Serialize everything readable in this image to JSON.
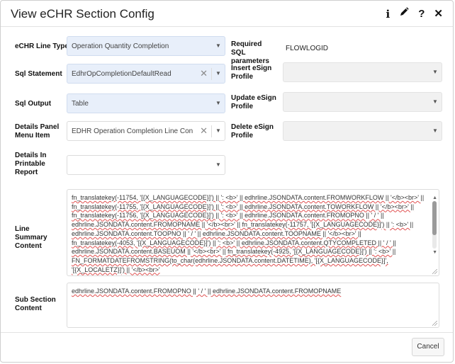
{
  "dialog": {
    "title": "View eCHR Section Config",
    "icons": [
      "info-icon",
      "pencil-icon",
      "help-icon",
      "close-icon"
    ]
  },
  "fields": {
    "line_type": {
      "label": "eCHR Line Type",
      "value": "Operation Quantity Completion"
    },
    "sql_statement": {
      "label": "Sql Statement",
      "value": "EdhrOpCompletionDefaultRead"
    },
    "sql_output": {
      "label": "Sql Output",
      "value": "Table"
    },
    "details_panel": {
      "label": "Details Panel Menu Item",
      "value": "EDHR Operation Completion Line Con..."
    },
    "details_printable": {
      "label": "Details In Printable Report",
      "value": ""
    },
    "required_sql": {
      "label": "Required SQL parameters",
      "value": "FLOWLOGID"
    },
    "insert_esign": {
      "label": "Insert eSign Profile",
      "value": ""
    },
    "update_esign": {
      "label": "Update eSign Profile",
      "value": ""
    },
    "delete_esign": {
      "label": "Delete eSign Profile",
      "value": ""
    },
    "line_summary": {
      "label": "Line Summary Content",
      "value": "fn_translatekey(-11754, '[{X_LANGUAGECODE}]') || ': <b>' || edhrline.JSONDATA.content.FROMWORKFLOW || '</b><br>' || fn_translatekey(-11755, '[{X_LANGUAGECODE}]') || ': <b>' || edhrline.JSONDATA.content.TOWORKFLOW || '</b><br>' || fn_translatekey(-11756, '[{X_LANGUAGECODE}]') || ': <b>' || edhrline.JSONDATA.content.FROMOPNO || ' / ' || edhrline.JSONDATA.content.FROMOPNAME || '</b><br>' || fn_translatekey(-11757, '[{X_LANGUAGECODE}]') || ': <b>' || edhrline.JSONDATA.content.TOOPNO || ' / ' || edhrline.JSONDATA.content.TOOPNAME || '</b><br>' || fn_translatekey(-4053, '[{X_LANGUAGECODE}]') || ': <b>' || edhrline.JSONDATA.content.QTYCOMPLETED || ' / ' || edhrline.JSONDATA.content.BASEUOM || '</b><br>' || fn_translatekey(-4925, '[{X_LANGUAGECODE}]') || ': <b>' || FN_FORMATDATEFROMSTRING(to_char(edhrline.JSONDATA.content.DATETIME), '[{X_LANGUAGECODE}]', '[{X_LOCALETZ}]') || '</b><br>'"
    },
    "sub_section": {
      "label": "Sub Section Content",
      "value": "edhrline.JSONDATA.content.FROMOPNO || ' / ' || edhrline.JSONDATA.content.FROMOPNAME"
    }
  },
  "footer": {
    "cancel_label": "Cancel"
  }
}
